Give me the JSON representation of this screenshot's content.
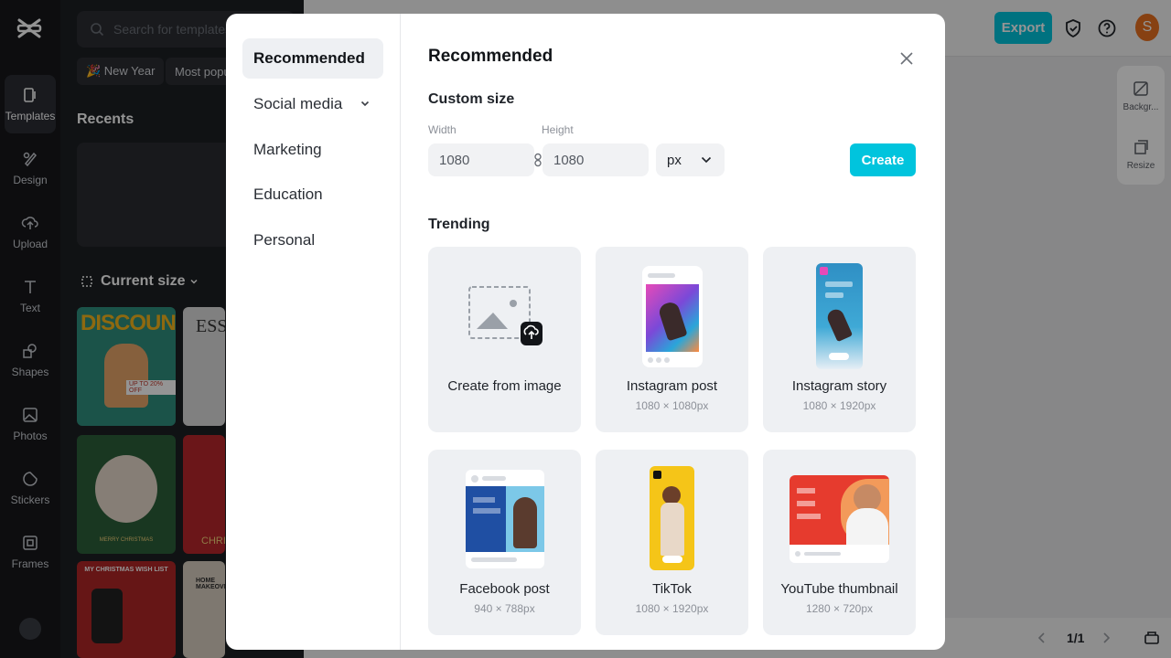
{
  "rail": {
    "items": [
      {
        "label": "Templates",
        "icon": "templates-icon"
      },
      {
        "label": "Design",
        "icon": "design-icon"
      },
      {
        "label": "Upload",
        "icon": "upload-icon"
      },
      {
        "label": "Text",
        "icon": "text-icon"
      },
      {
        "label": "Shapes",
        "icon": "shapes-icon"
      },
      {
        "label": "Photos",
        "icon": "photos-icon"
      },
      {
        "label": "Stickers",
        "icon": "stickers-icon"
      },
      {
        "label": "Frames",
        "icon": "frames-icon"
      }
    ]
  },
  "panel": {
    "search_placeholder": "Search for templates",
    "chips": [
      "🎉 New Year",
      "Most popu"
    ],
    "recents_title": "Recents",
    "current_size": "Current size",
    "thumb_texts": {
      "discount": "DISCOUNT",
      "discount_badge": "UP TO 20% OFF",
      "ess": "ESS",
      "merry": "MERRY CHRISTMAS",
      "chr": "CHRI",
      "wishlist": "MY CHRISTMAS WISH LIST",
      "home": "HOME MAKEOVER"
    }
  },
  "topbar": {
    "export_label": "Export",
    "avatar_letter": "S"
  },
  "right_tools": [
    {
      "label": "Backgr...",
      "icon": "background-icon"
    },
    {
      "label": "Resize",
      "icon": "resize-icon"
    }
  ],
  "pager": "1/1",
  "modal": {
    "nav": [
      "Recommended",
      "Social media",
      "Marketing",
      "Education",
      "Personal"
    ],
    "title": "Recommended",
    "custom_size": {
      "heading": "Custom size",
      "width_label": "Width",
      "height_label": "Height",
      "width_value": "1080",
      "height_value": "1080",
      "unit": "px",
      "create_label": "Create"
    },
    "trending_heading": "Trending",
    "cards": [
      {
        "name": "Create from image",
        "size": ""
      },
      {
        "name": "Instagram post",
        "size": "1080 × 1080px"
      },
      {
        "name": "Instagram story",
        "size": "1080 × 1920px"
      },
      {
        "name": "Facebook post",
        "size": "940 × 788px"
      },
      {
        "name": "TikTok",
        "size": "1080 × 1920px"
      },
      {
        "name": "YouTube thumbnail",
        "size": "1280 × 720px"
      }
    ]
  },
  "colors": {
    "accent": "#00c4dd",
    "rail_bg": "#17181b",
    "panel_bg": "#1d1f23",
    "card_bg": "#eef0f3"
  }
}
